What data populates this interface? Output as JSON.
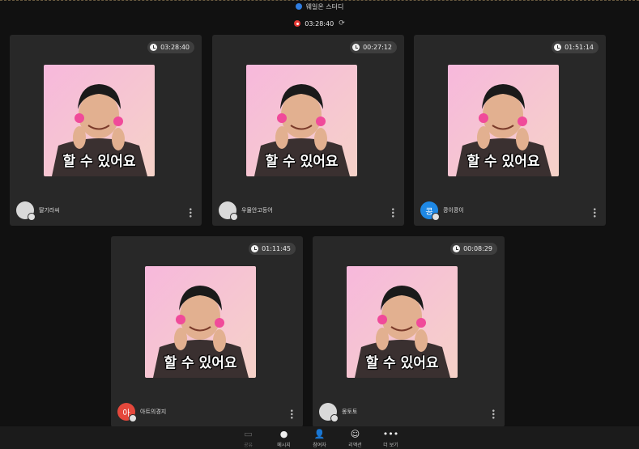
{
  "header": {
    "room_title": "웨일온 스터디",
    "timer": "03:28:40"
  },
  "photo_caption": "할 수 있어요",
  "tiles": [
    {
      "time": "03:28:40",
      "name": "딸기라씨",
      "avatar_text": ""
    },
    {
      "time": "00:27:12",
      "name": "우물안고등어",
      "avatar_text": ""
    },
    {
      "time": "01:51:14",
      "name": "콩이콩이",
      "avatar_text": "콩"
    },
    {
      "time": "01:11:45",
      "name": "아트의경지",
      "avatar_text": "아"
    },
    {
      "time": "00:08:29",
      "name": "몽토토",
      "avatar_text": ""
    }
  ],
  "toolbar": {
    "items": [
      {
        "label": "공유",
        "icon": "screen-share-icon"
      },
      {
        "label": "메시지",
        "icon": "chat-icon"
      },
      {
        "label": "참여자",
        "icon": "participants-icon"
      },
      {
        "label": "리액션",
        "icon": "reaction-icon"
      },
      {
        "label": "더 보기",
        "icon": "more-icon"
      }
    ]
  },
  "colors": {
    "background": "#111111",
    "tile": "#282828",
    "accent_blue": "#1e88e5",
    "record_red": "#e53935"
  }
}
